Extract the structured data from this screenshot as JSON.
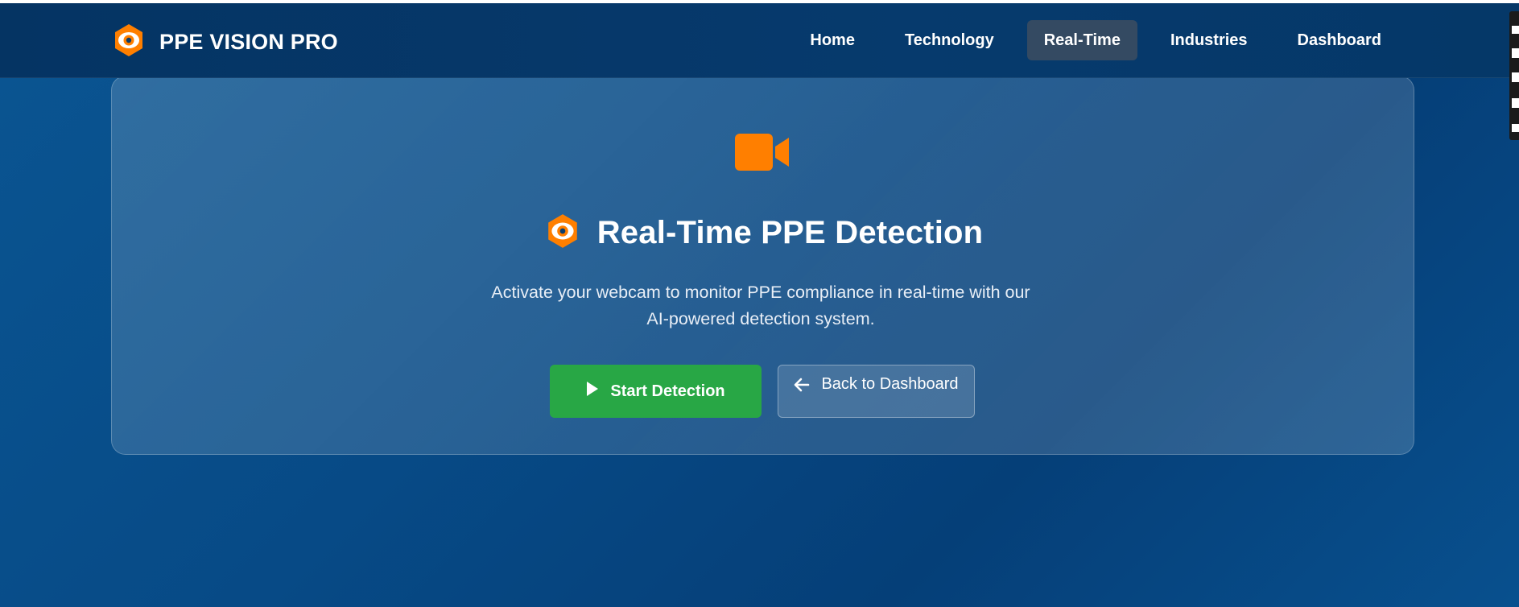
{
  "navbar": {
    "brand": "PPE VISION PRO",
    "items": [
      {
        "label": "Home"
      },
      {
        "label": "Technology"
      },
      {
        "label": "Real-Time",
        "active": true
      },
      {
        "label": "Industries"
      },
      {
        "label": "Dashboard"
      }
    ]
  },
  "hero": {
    "icon": "video-camera-icon",
    "title": "Real-Time PPE Detection",
    "subtitle_line1": "Activate your webcam to monitor PPE compliance in real-time with our",
    "subtitle_line2": "AI-powered detection system.",
    "start_button": "Start Detection",
    "back_button": "Back to Dashboard"
  },
  "colors": {
    "accent": "#ff7f00",
    "success": "#28a745",
    "navbar": "#053463",
    "background": "#074a86"
  }
}
